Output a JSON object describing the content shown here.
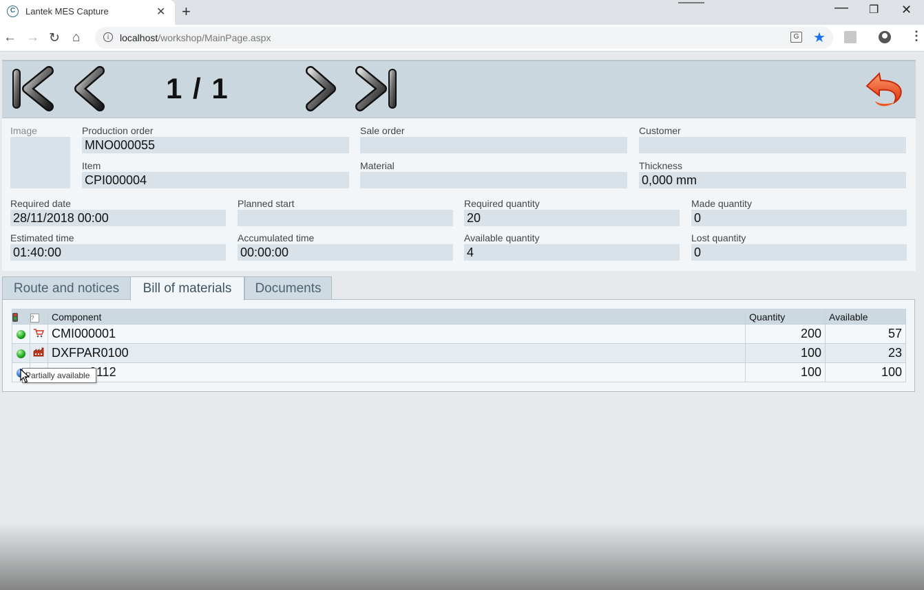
{
  "browser": {
    "tab_title": "Lantek MES Capture",
    "favicon_letter": "C",
    "url_host": "localhost",
    "url_path": "/workshop/MainPage.aspx"
  },
  "app": {
    "pager": "1 / 1",
    "fields": {
      "image_label": "Image",
      "production_order_label": "Production order",
      "production_order": "MNO000055",
      "sale_order_label": "Sale order",
      "sale_order": "",
      "customer_label": "Customer",
      "customer": "",
      "item_label": "Item",
      "item": "CPI000004",
      "material_label": "Material",
      "material": "",
      "thickness_label": "Thickness",
      "thickness": "0,000 mm",
      "required_date_label": "Required date",
      "required_date": "28/11/2018 00:00",
      "planned_start_label": "Planned start",
      "planned_start": "",
      "required_quantity_label": "Required quantity",
      "required_quantity": "20",
      "made_quantity_label": "Made quantity",
      "made_quantity": "0",
      "estimated_time_label": "Estimated time",
      "estimated_time": "01:40:00",
      "accumulated_time_label": "Accumulated time",
      "accumulated_time": "00:00:00",
      "available_quantity_label": "Available quantity",
      "available_quantity": "4",
      "lost_quantity_label": "Lost quantity",
      "lost_quantity": "0"
    },
    "tabs": [
      {
        "label": "Route and notices"
      },
      {
        "label": "Bill of materials"
      },
      {
        "label": "Documents"
      }
    ],
    "grid": {
      "question_glyph": "?",
      "headers": {
        "component": "Component",
        "quantity": "Quantity",
        "available": "Available"
      },
      "rows": [
        {
          "component": "CMI000001",
          "quantity": "200",
          "available": "57",
          "status": "green",
          "type": "cart-icon"
        },
        {
          "component": "DXFPAR0100",
          "quantity": "100",
          "available": "23",
          "status": "green",
          "type": "factory-icon"
        },
        {
          "component": "0112",
          "quantity": "100",
          "available": "100",
          "status": "blue",
          "type": ""
        }
      ]
    },
    "tooltip": "Partially available"
  }
}
